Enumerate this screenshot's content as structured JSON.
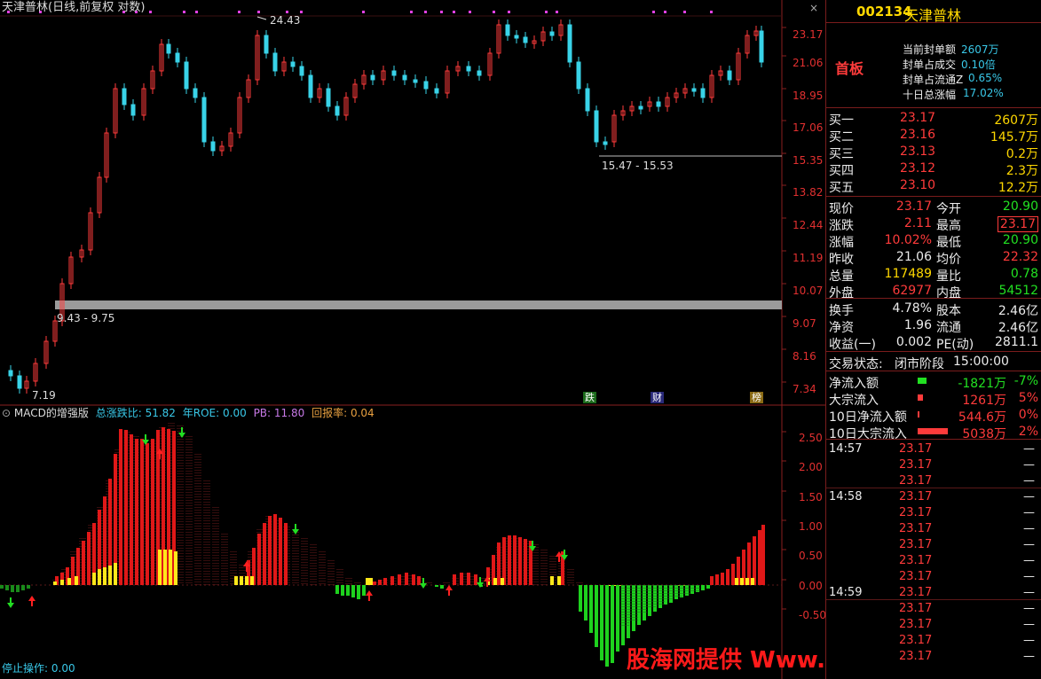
{
  "header": {
    "title": "天津普林(日线,前复权 对数)",
    "close_symbol": "×"
  },
  "price_axis": [
    "23.17",
    "21.06",
    "18.95",
    "17.06",
    "15.35",
    "13.82",
    "12.44",
    "11.19",
    "10.07",
    "9.07",
    "8.16",
    "7.34"
  ],
  "annotations": {
    "high_label": "24.43",
    "low_label": "7.19",
    "gap_low": "9.43 - 9.75",
    "gap_high": "15.47 - 15.53"
  },
  "event_tags": [
    "跌",
    "财",
    "榜"
  ],
  "indicator": {
    "title": "MACD的增强版",
    "zdzb_label": "总涨跌比:",
    "zdzb_value": "51.82",
    "roe_label": "年ROE:",
    "roe_value": "0.00",
    "pb_label": "PB:",
    "pb_value": "11.80",
    "hbl_label": "回报率:",
    "hbl_value": "0.04",
    "axis": [
      "2.50",
      "2.00",
      "1.50",
      "1.00",
      "0.50",
      "0.00",
      "-0.50"
    ],
    "stop_label": "停止操作:",
    "stop_value": "0.00"
  },
  "watermark": "股海网提供 Www.Guhai.Com.CN",
  "sidebar": {
    "code": "002134",
    "name": "天津普林",
    "badge": "首板",
    "seal": [
      {
        "label": "当前封单额",
        "value": "2607万"
      },
      {
        "label": "封单占成交",
        "value": "0.10倍"
      },
      {
        "label": "封单占流通Z",
        "value": "0.65%"
      },
      {
        "label": "十日总涨幅",
        "value": "17.02%"
      }
    ],
    "bids": [
      {
        "label": "买一",
        "price": "23.17",
        "vol": "2607万"
      },
      {
        "label": "买二",
        "price": "23.16",
        "vol": "145.7万"
      },
      {
        "label": "买三",
        "price": "23.13",
        "vol": "0.2万"
      },
      {
        "label": "买四",
        "price": "23.12",
        "vol": "2.3万"
      },
      {
        "label": "买五",
        "price": "23.10",
        "vol": "12.2万"
      }
    ],
    "quote": [
      {
        "l1": "现价",
        "v1": "23.17",
        "l2": "今开",
        "v2": "20.90"
      },
      {
        "l1": "涨跌",
        "v1": "2.11",
        "l2": "最高",
        "v2": "23.17"
      },
      {
        "l1": "涨幅",
        "v1": "10.02%",
        "l2": "最低",
        "v2": "20.90"
      },
      {
        "l1": "昨收",
        "v1": "21.06",
        "l2": "均价",
        "v2": "22.32"
      },
      {
        "l1": "总量",
        "v1": "117489",
        "l2": "量比",
        "v2": "0.78"
      },
      {
        "l1": "外盘",
        "v1": "62977",
        "l2": "内盘",
        "v2": "54512"
      }
    ],
    "fund": [
      {
        "l1": "换手",
        "v1": "4.78%",
        "l2": "股本",
        "v2": "2.46亿"
      },
      {
        "l1": "净资",
        "v1": "1.96",
        "l2": "流通",
        "v2": "2.46亿"
      },
      {
        "l1": "收益(一)",
        "v1": "0.002",
        "l2": "PE(动)",
        "v2": "2811.1"
      }
    ],
    "status_label": "交易状态:",
    "status_value": "闭市阶段",
    "status_time": "15:00:00",
    "flows": [
      {
        "label": "净流入额",
        "value": "-1821万",
        "pct": "-7%"
      },
      {
        "label": "大宗流入",
        "value": "1261万",
        "pct": "5%"
      },
      {
        "label": "10日净流入额",
        "value": "544.6万",
        "pct": "0%"
      },
      {
        "label": "10日大宗流入",
        "value": "5038万",
        "pct": "2%"
      }
    ],
    "ticks": [
      {
        "time": "14:57",
        "price": "23.17",
        "vol": "—"
      },
      {
        "time": "",
        "price": "23.17",
        "vol": "—"
      },
      {
        "time": "",
        "price": "23.17",
        "vol": "—"
      },
      {
        "time": "14:58",
        "price": "23.17",
        "vol": "—"
      },
      {
        "time": "",
        "price": "23.17",
        "vol": "—"
      },
      {
        "time": "",
        "price": "23.17",
        "vol": "—"
      },
      {
        "time": "",
        "price": "23.17",
        "vol": "—"
      },
      {
        "time": "",
        "price": "23.17",
        "vol": "—"
      },
      {
        "time": "",
        "price": "23.17",
        "vol": "—"
      },
      {
        "time": "14:59",
        "price": "23.17",
        "vol": "—"
      },
      {
        "time": "",
        "price": "23.17",
        "vol": "—"
      },
      {
        "time": "",
        "price": "23.17",
        "vol": "—"
      },
      {
        "time": "",
        "price": "23.17",
        "vol": "—"
      },
      {
        "time": "",
        "price": "23.17",
        "vol": "—"
      }
    ]
  }
}
